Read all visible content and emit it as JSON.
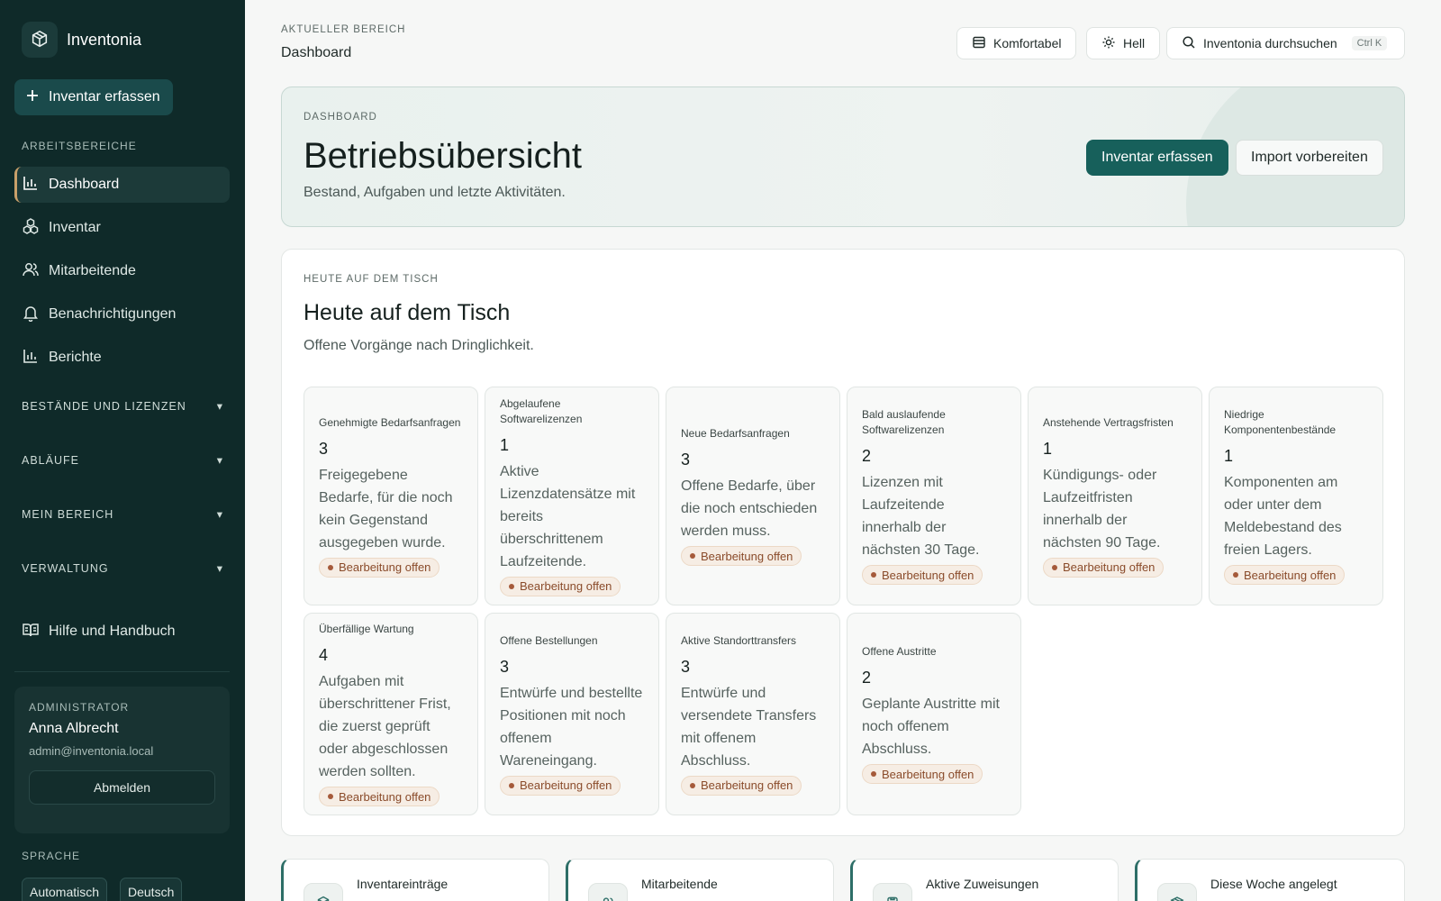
{
  "app": {
    "name": "Inventonia"
  },
  "sidebar": {
    "add_button": "Inventar erfassen",
    "section_label": "ARBEITSBEREICHE",
    "items": [
      {
        "label": "Dashboard",
        "icon": "bar-chart-icon",
        "active": true
      },
      {
        "label": "Inventar",
        "icon": "boxes-icon"
      },
      {
        "label": "Mitarbeitende",
        "icon": "users-icon"
      },
      {
        "label": "Benachrichtigungen",
        "icon": "bell-icon"
      },
      {
        "label": "Berichte",
        "icon": "bar-chart-icon"
      }
    ],
    "groups": [
      {
        "label": "BESTÄNDE UND LIZENZEN",
        "chevron": "▾"
      },
      {
        "label": "ABLÄUFE",
        "chevron": "▾"
      },
      {
        "label": "MEIN BEREICH",
        "chevron": "▾"
      },
      {
        "label": "VERWALTUNG",
        "chevron": "▾"
      }
    ],
    "help": "Hilfe und Handbuch",
    "user": {
      "role": "ADMINISTRATOR",
      "name": "Anna Albrecht",
      "email": "admin@inventonia.local",
      "logout": "Abmelden"
    },
    "language": {
      "label": "SPRACHE",
      "options": [
        "Automatisch",
        "Deutsch"
      ]
    }
  },
  "header": {
    "crumb_label": "AKTUELLER BEREICH",
    "crumb_title": "Dashboard",
    "density": "Komfortabel",
    "theme": "Hell",
    "search": "Inventonia durchsuchen",
    "shortcut": "Ctrl K"
  },
  "hero": {
    "label": "DASHBOARD",
    "title": "Betriebsübersicht",
    "subtitle": "Bestand, Aufgaben und letzte Aktivitäten.",
    "primary": "Inventar erfassen",
    "secondary": "Import vorbereiten"
  },
  "today": {
    "label": "HEUTE AUF DEM TISCH",
    "title": "Heute auf dem Tisch",
    "subtitle": "Offene Vorgänge nach Dringlichkeit.",
    "cards": [
      {
        "title": "Genehmigte Bedarfsanfragen",
        "count": "3",
        "desc": "Freigegebene Bedarfe, für die noch kein Gegenstand ausgegeben wurde.",
        "status": "Bearbeitung offen"
      },
      {
        "title": "Abgelaufene Softwarelizenzen",
        "count": "1",
        "desc": "Aktive Lizenzdatensätze mit bereits überschrittenem Laufzeitende.",
        "status": "Bearbeitung offen"
      },
      {
        "title": "Neue Bedarfsanfragen",
        "count": "3",
        "desc": "Offene Bedarfe, über die noch entschieden werden muss.",
        "status": "Bearbeitung offen"
      },
      {
        "title": "Bald auslaufende Softwarelizenzen",
        "count": "2",
        "desc": "Lizenzen mit Laufzeitende innerhalb der nächsten 30 Tage.",
        "status": "Bearbeitung offen"
      },
      {
        "title": "Anstehende Vertragsfristen",
        "count": "1",
        "desc": "Kündigungs- oder Laufzeitfristen innerhalb der nächsten 90 Tage.",
        "status": "Bearbeitung offen"
      },
      {
        "title": "Niedrige Komponentenbestände",
        "count": "1",
        "desc": "Komponenten am oder unter dem Meldebestand des freien Lagers.",
        "status": "Bearbeitung offen"
      },
      {
        "title": "Überfällige Wartung",
        "count": "4",
        "desc": "Aufgaben mit überschrittener Frist, die zuerst geprüft oder abgeschlossen werden sollten.",
        "status": "Bearbeitung offen"
      },
      {
        "title": "Offene Bestellungen",
        "count": "3",
        "desc": "Entwürfe und bestellte Positionen mit noch offenem Wareneingang.",
        "status": "Bearbeitung offen"
      },
      {
        "title": "Aktive Standorttransfers",
        "count": "3",
        "desc": "Entwürfe und versendete Transfers mit offenem Abschluss.",
        "status": "Bearbeitung offen"
      },
      {
        "title": "Offene Austritte",
        "count": "2",
        "desc": "Geplante Austritte mit noch offenem Abschluss.",
        "status": "Bearbeitung offen"
      }
    ]
  },
  "stats": [
    {
      "label": "Inventareinträge",
      "icon": "box-icon"
    },
    {
      "label": "Mitarbeitende",
      "icon": "users-icon"
    },
    {
      "label": "Aktive Zuweisungen",
      "icon": "clipboard-icon"
    },
    {
      "label": "Diese Woche angelegt",
      "icon": "package-icon"
    }
  ]
}
